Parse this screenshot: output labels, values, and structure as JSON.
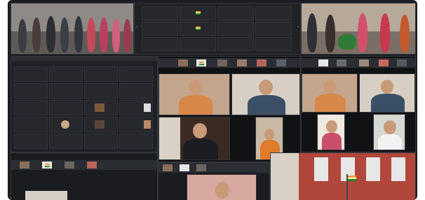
{
  "colors": {
    "frame_bg": "#1b1d22",
    "tile_bg": "#26282c",
    "accent": "#2d6cdf"
  },
  "windows": [
    {
      "title": ""
    }
  ],
  "participant_names": [],
  "icons": [
    "chevron-left-icon",
    "chevron-right-icon"
  ]
}
